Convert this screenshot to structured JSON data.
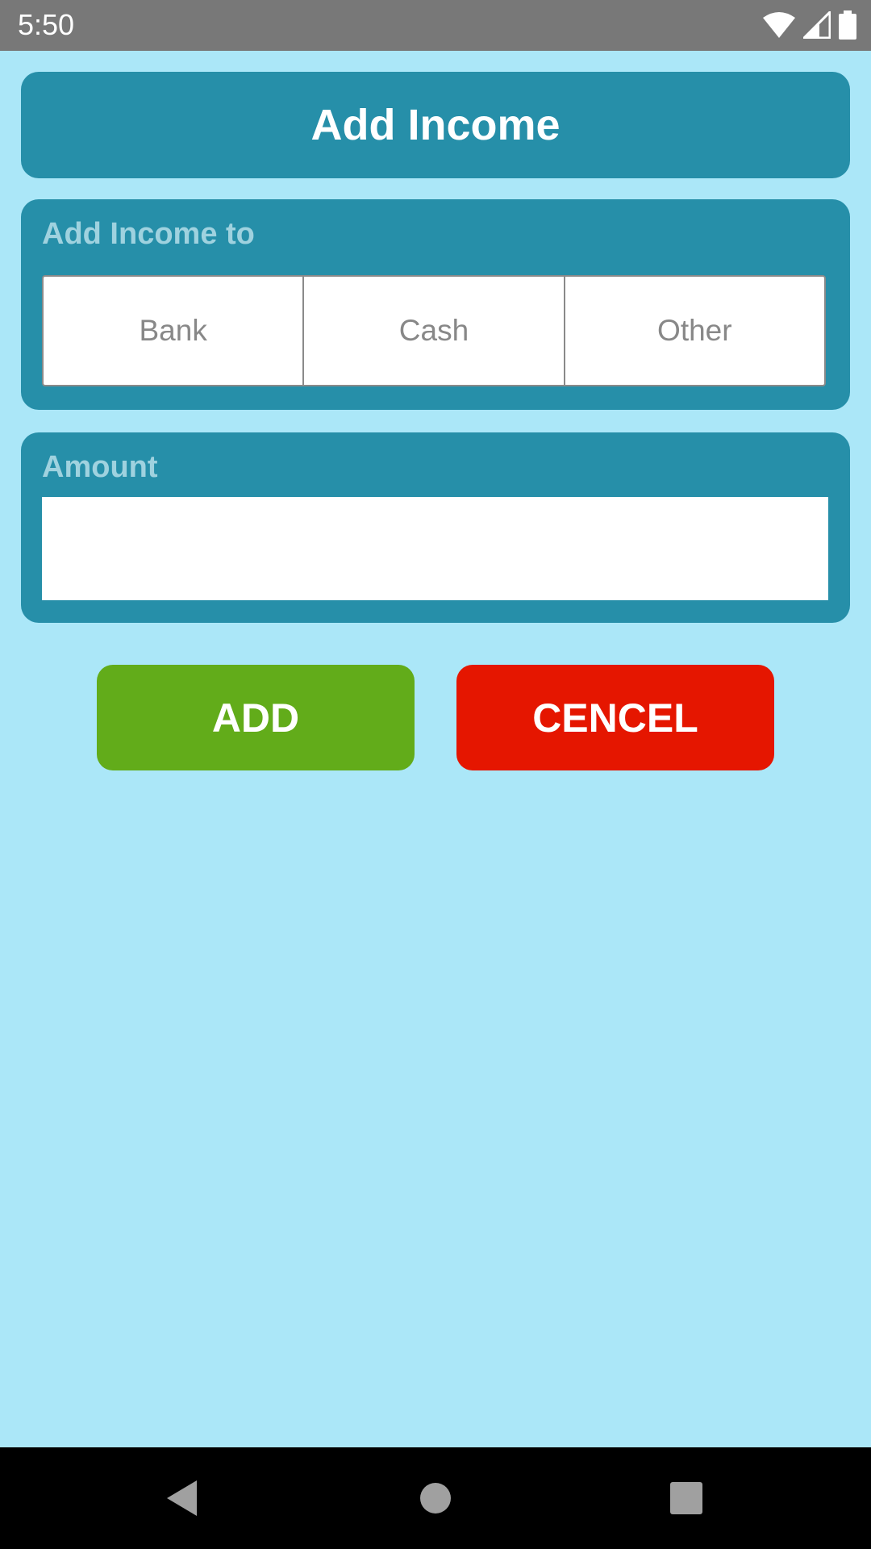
{
  "status_bar": {
    "time": "5:50",
    "icons": [
      "wifi-icon",
      "cellular-signal-icon",
      "battery-icon"
    ]
  },
  "header": {
    "title": "Add Income"
  },
  "income_to": {
    "label": "Add Income to",
    "options": [
      "Bank",
      "Cash",
      "Other"
    ]
  },
  "amount": {
    "label": "Amount",
    "value": ""
  },
  "actions": {
    "add_label": "ADD",
    "cancel_label": "CENCEL"
  },
  "nav_bar": {
    "icons": [
      "back-icon",
      "home-icon",
      "recents-icon"
    ]
  },
  "colors": {
    "background": "#abe7f8",
    "card": "#268fa9",
    "card_label": "#9fd2df",
    "add_button": "#62ac1a",
    "cancel_button": "#e51600",
    "status_bar": "#787878",
    "nav_bar": "#000000"
  }
}
